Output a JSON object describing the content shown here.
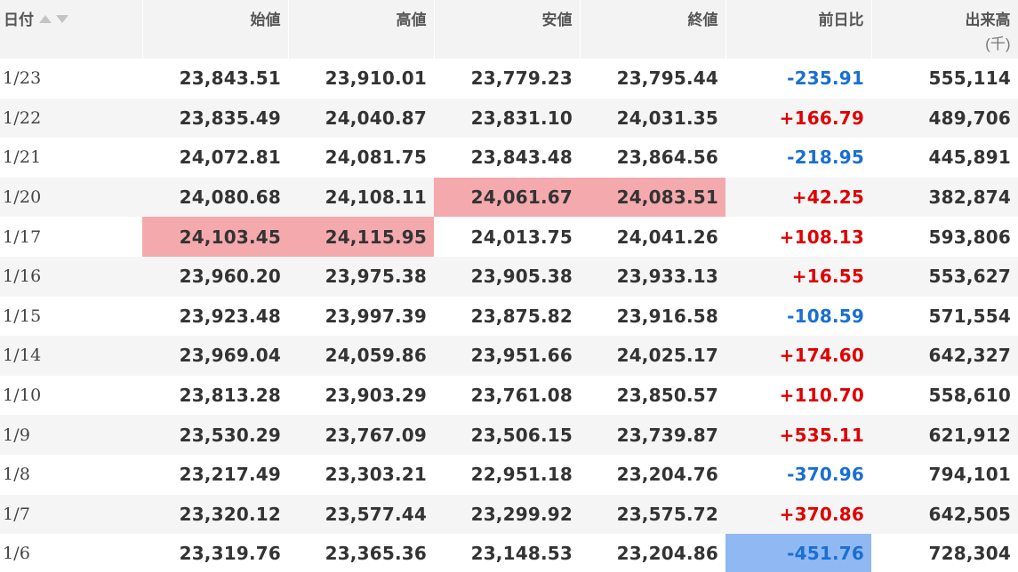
{
  "headers": {
    "date": "日付",
    "open": "始値",
    "high": "高値",
    "low": "安値",
    "close": "終値",
    "change": "前日比",
    "volume": "出来高",
    "volume_unit": "(千)"
  },
  "rows": [
    {
      "date": "1/23",
      "open": "23,843.51",
      "high": "23,910.01",
      "low": "23,779.23",
      "close": "23,795.44",
      "change": "-235.91",
      "volume": "555,114"
    },
    {
      "date": "1/22",
      "open": "23,835.49",
      "high": "24,040.87",
      "low": "23,831.10",
      "close": "24,031.35",
      "change": "+166.79",
      "volume": "489,706"
    },
    {
      "date": "1/21",
      "open": "24,072.81",
      "high": "24,081.75",
      "low": "23,843.48",
      "close": "23,864.56",
      "change": "-218.95",
      "volume": "445,891"
    },
    {
      "date": "1/20",
      "open": "24,080.68",
      "high": "24,108.11",
      "low": "24,061.67",
      "close": "24,083.51",
      "change": "+42.25",
      "volume": "382,874"
    },
    {
      "date": "1/17",
      "open": "24,103.45",
      "high": "24,115.95",
      "low": "24,013.75",
      "close": "24,041.26",
      "change": "+108.13",
      "volume": "593,806"
    },
    {
      "date": "1/16",
      "open": "23,960.20",
      "high": "23,975.38",
      "low": "23,905.38",
      "close": "23,933.13",
      "change": "+16.55",
      "volume": "553,627"
    },
    {
      "date": "1/15",
      "open": "23,923.48",
      "high": "23,997.39",
      "low": "23,875.82",
      "close": "23,916.58",
      "change": "-108.59",
      "volume": "571,554"
    },
    {
      "date": "1/14",
      "open": "23,969.04",
      "high": "24,059.86",
      "low": "23,951.66",
      "close": "24,025.17",
      "change": "+174.60",
      "volume": "642,327"
    },
    {
      "date": "1/10",
      "open": "23,813.28",
      "high": "23,903.29",
      "low": "23,761.08",
      "close": "23,850.57",
      "change": "+110.70",
      "volume": "558,610"
    },
    {
      "date": "1/9",
      "open": "23,530.29",
      "high": "23,767.09",
      "low": "23,506.15",
      "close": "23,739.87",
      "change": "+535.11",
      "volume": "621,912"
    },
    {
      "date": "1/8",
      "open": "23,217.49",
      "high": "23,303.21",
      "low": "22,951.18",
      "close": "23,204.76",
      "change": "-370.96",
      "volume": "794,101"
    },
    {
      "date": "1/7",
      "open": "23,320.12",
      "high": "23,577.44",
      "low": "23,299.92",
      "close": "23,575.72",
      "change": "+370.86",
      "volume": "642,505"
    },
    {
      "date": "1/6",
      "open": "23,319.76",
      "high": "23,365.36",
      "low": "23,148.53",
      "close": "23,204.86",
      "change": "-451.76",
      "volume": "728,304"
    }
  ],
  "colors": {
    "positive": "#e00000",
    "negative": "#1a6fd1",
    "highlight_red": "#f4a9ad",
    "highlight_blue": "#90b8f2",
    "header_bg": "#f3f3f3",
    "stripe_bg": "#f5f5f5"
  },
  "icons": {
    "sort_asc": "sort-ascending-icon",
    "sort_desc": "sort-descending-icon"
  }
}
